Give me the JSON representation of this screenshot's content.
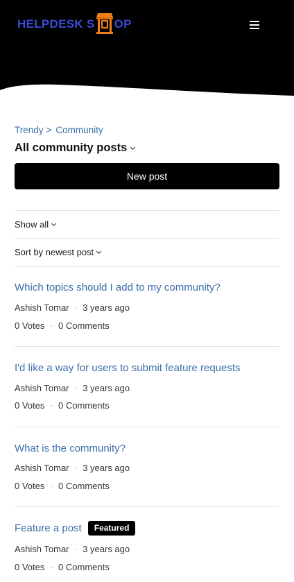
{
  "header": {
    "logo": {
      "text_left": "HELPDESK S",
      "text_right": "OP",
      "full_text": "HELPDESK SHOP"
    },
    "menu_icon": "hamburger-menu-icon",
    "colors": {
      "background": "#000000",
      "logo_text": "#3a4bd8",
      "logo_mark": "#f07f1a"
    }
  },
  "breadcrumb": {
    "items": [
      {
        "label": "Trendy"
      },
      {
        "label": "Community"
      }
    ],
    "separator": ">"
  },
  "page": {
    "title": "All community posts",
    "new_post_label": "New post"
  },
  "filters": {
    "show_label": "Show all",
    "sort_label": "Sort by newest post"
  },
  "posts": [
    {
      "title": "Which topics should I add to my community?",
      "author": "Ashish Tomar",
      "time": "3 years ago",
      "votes": "0 Votes",
      "comments": "0 Comments",
      "badge": ""
    },
    {
      "title": "I'd like a way for users to submit feature requests",
      "author": "Ashish Tomar",
      "time": "3 years ago",
      "votes": "0 Votes",
      "comments": "0 Comments",
      "badge": ""
    },
    {
      "title": "What is the community?",
      "author": "Ashish Tomar",
      "time": "3 years ago",
      "votes": "0 Votes",
      "comments": "0 Comments",
      "badge": ""
    },
    {
      "title": "Feature a post",
      "author": "Ashish Tomar",
      "time": "3 years ago",
      "votes": "0 Votes",
      "comments": "0 Comments",
      "badge": "Featured"
    }
  ],
  "colors": {
    "link": "#3a6fa8",
    "button_bg": "#000000",
    "button_text": "#ffffff",
    "divider": "#e3e3e3"
  }
}
